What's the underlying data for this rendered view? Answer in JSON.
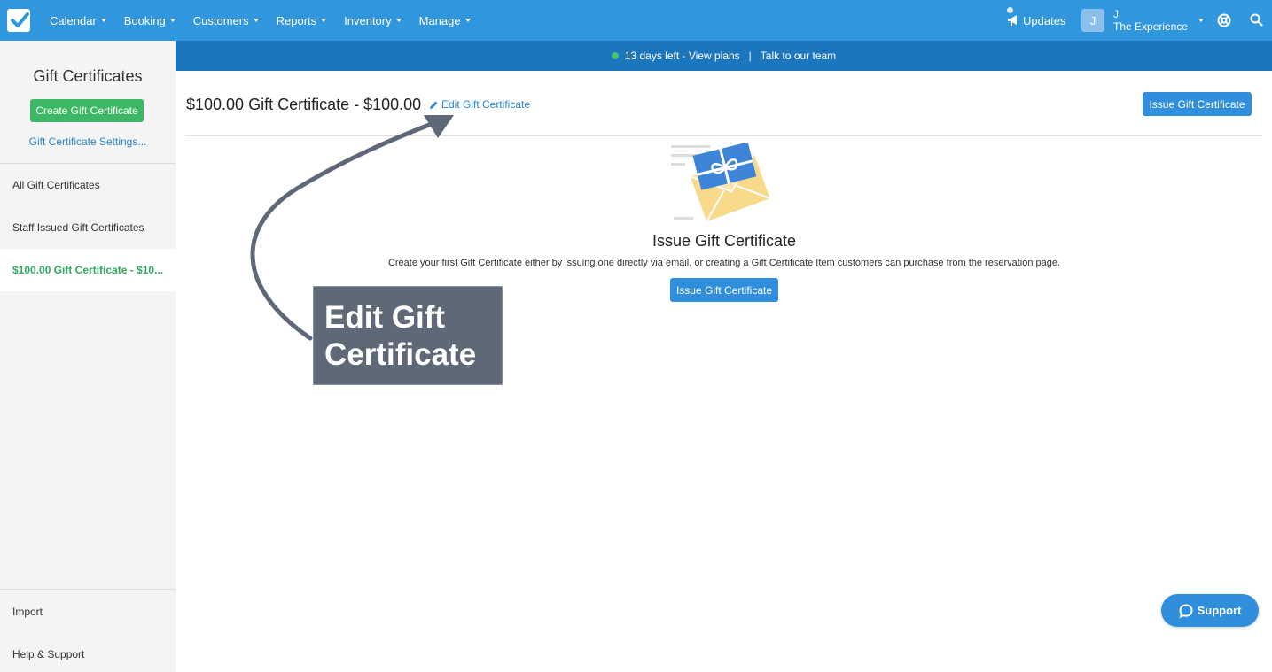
{
  "nav": {
    "items": [
      {
        "label": "Calendar"
      },
      {
        "label": "Booking"
      },
      {
        "label": "Customers"
      },
      {
        "label": "Reports"
      },
      {
        "label": "Inventory"
      },
      {
        "label": "Manage"
      }
    ],
    "updates_label": "Updates",
    "user": {
      "initial": "J",
      "name": "J",
      "business": "The Experience"
    }
  },
  "banner": {
    "trial_text": "13 days left - View plans",
    "separator": "|",
    "team_text": "Talk to our team"
  },
  "sidebar": {
    "title": "Gift Certificates",
    "create_button": "Create Gift Certificate",
    "settings_link": "Gift Certificate Settings...",
    "items": [
      {
        "label": "All Gift Certificates"
      },
      {
        "label": "Staff Issued Gift Certificates"
      },
      {
        "label": "$100.00 Gift Certificate - $10..."
      }
    ],
    "footer_items": [
      {
        "label": "Import"
      },
      {
        "label": "Help & Support"
      }
    ]
  },
  "main": {
    "title": "$100.00 Gift Certificate - $100.00",
    "edit_link": "Edit Gift Certificate",
    "issue_button": "Issue Gift Certificate",
    "empty_state": {
      "title": "Issue Gift Certificate",
      "description": "Create your first Gift Certificate either by issuing one directly via email, or creating a Gift Certificate Item customers can purchase from the reservation page.",
      "button": "Issue Gift Certificate"
    }
  },
  "annotation": {
    "line1": "Edit Gift",
    "line2": "Certificate"
  },
  "support": {
    "label": "Support"
  },
  "colors": {
    "nav_blue": "#3096dd",
    "banner_blue": "#1c76bd",
    "green": "#3cb763",
    "link_blue": "#2a86cf",
    "callout": "#5f6877"
  }
}
